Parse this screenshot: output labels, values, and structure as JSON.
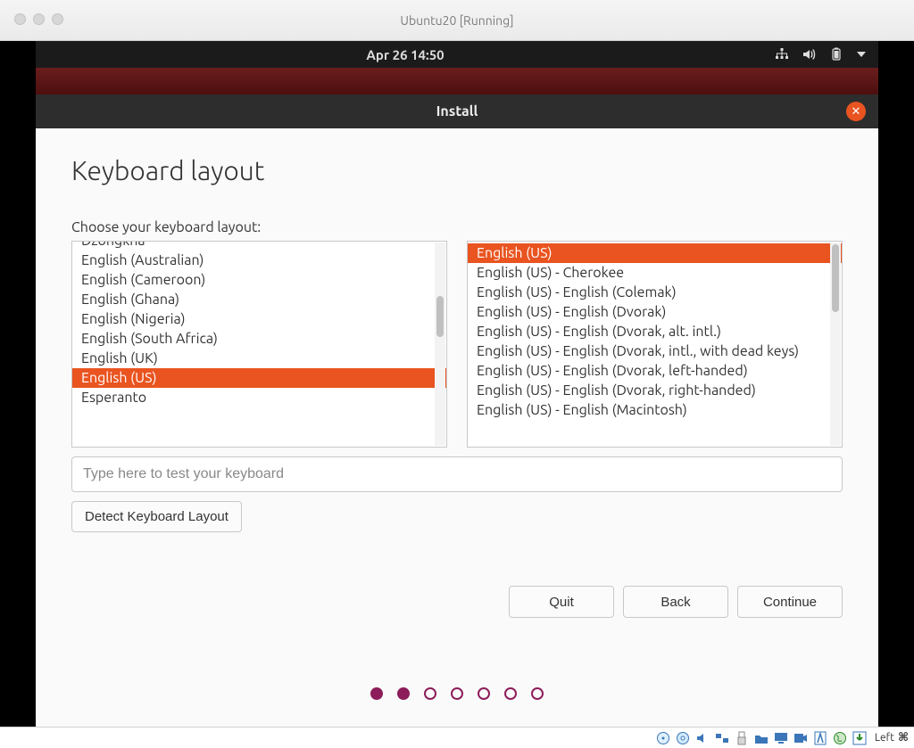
{
  "host": {
    "window_title": "Ubuntu20  [Running]",
    "status_text": "Left",
    "status_cmd_glyph": "⌘"
  },
  "topbar": {
    "datetime": "Apr 26  14:50"
  },
  "installer": {
    "titlebar": "Install",
    "close_glyph": "✕",
    "heading": "Keyboard layout",
    "prompt": "Choose your keyboard layout:",
    "left_list": {
      "items": [
        "Dzongkha",
        "English (Australian)",
        "English (Cameroon)",
        "English (Ghana)",
        "English (Nigeria)",
        "English (South Africa)",
        "English (UK)",
        "English (US)",
        "Esperanto"
      ],
      "selected_index": 7
    },
    "right_list": {
      "items": [
        "English (US)",
        "English (US) - Cherokee",
        "English (US) - English (Colemak)",
        "English (US) - English (Dvorak)",
        "English (US) - English (Dvorak, alt. intl.)",
        "English (US) - English (Dvorak, intl., with dead keys)",
        "English (US) - English (Dvorak, left-handed)",
        "English (US) - English (Dvorak, right-handed)",
        "English (US) - English (Macintosh)"
      ],
      "selected_index": 0
    },
    "test_placeholder": "Type here to test your keyboard",
    "detect_button": "Detect Keyboard Layout",
    "nav": {
      "quit": "Quit",
      "back": "Back",
      "continue": "Continue"
    },
    "progress": {
      "total": 7,
      "current": 2
    }
  },
  "colors": {
    "ubuntu_orange": "#e95420",
    "ubuntu_purple": "#8c1d5a"
  }
}
